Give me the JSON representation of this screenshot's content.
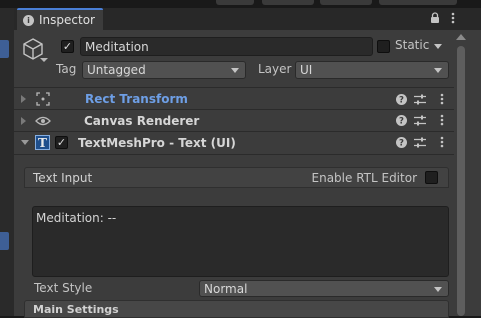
{
  "window": {
    "tab_title": "Inspector"
  },
  "game_object": {
    "active": true,
    "name": "Meditation",
    "static_label": "Static",
    "static_checked": false,
    "tag_label": "Tag",
    "tag_value": "Untagged",
    "layer_label": "Layer",
    "layer_value": "UI"
  },
  "components": [
    {
      "name": "Rect Transform",
      "icon": "rect-transform-icon",
      "expanded": false,
      "highlight": true
    },
    {
      "name": "Canvas Renderer",
      "icon": "eye-icon",
      "expanded": false,
      "highlight": false
    },
    {
      "name": "TextMeshPro - Text (UI)",
      "icon": "textmeshpro-icon",
      "expanded": true,
      "enabled": true,
      "highlight": false
    }
  ],
  "text_input": {
    "section_title": "Text Input",
    "rtl_label": "Enable RTL Editor",
    "rtl_checked": false,
    "text": "Meditation: --"
  },
  "text_style": {
    "label": "Text Style",
    "value": "Normal"
  },
  "main_settings": {
    "title": "Main Settings"
  },
  "colors": {
    "accent": "#4a7fd6",
    "link": "#6e9fe6",
    "background": "#3c3c3c"
  }
}
